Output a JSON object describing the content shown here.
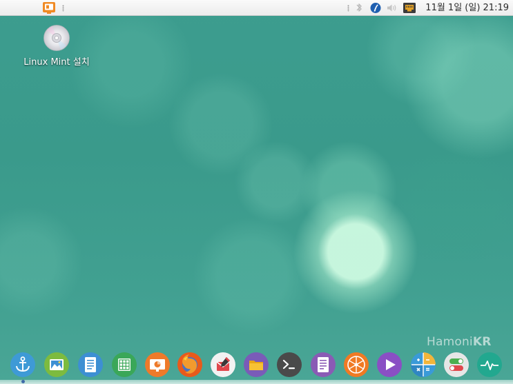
{
  "panel": {
    "clock": "11월  1일 (일) 21:19",
    "tray_icons": [
      "bluetooth-icon",
      "xapp-status-icon",
      "volume-icon",
      "network-icon"
    ],
    "menu_icon": "menu-icon"
  },
  "desktop": {
    "icons": [
      {
        "label": "Linux Mint 설치",
        "icon": "cd-disc-icon"
      }
    ]
  },
  "watermark": {
    "prefix": "Hamoni",
    "suffix": "KR"
  },
  "dock": {
    "items": [
      {
        "name": "anchor-icon",
        "color": "#3e9ad6"
      },
      {
        "name": "image-viewer-icon",
        "color": "#7dbb3f"
      },
      {
        "name": "text-document-icon",
        "color": "#3d8fd3"
      },
      {
        "name": "spreadsheet-icon",
        "color": "#3aa758"
      },
      {
        "name": "presentation-icon",
        "color": "#ee7a2a"
      },
      {
        "name": "firefox-icon",
        "color": "#e85a1b"
      },
      {
        "name": "mail-icon",
        "color": "#f2f2f2"
      },
      {
        "name": "folder-icon",
        "color": "#7a5bb8"
      },
      {
        "name": "terminal-icon",
        "color": "#4a4a4a"
      },
      {
        "name": "text-editor-icon",
        "color": "#8a5bb5"
      },
      {
        "name": "orange-app-icon",
        "color": "#f07a23"
      },
      {
        "name": "media-player-icon",
        "color": "#8a4fc4"
      },
      {
        "name": "calculator-icon",
        "color": "#3a9ad8"
      },
      {
        "name": "settings-toggle-icon",
        "color": "#e6e6e6"
      },
      {
        "name": "system-monitor-icon",
        "color": "#22a88f"
      }
    ]
  }
}
